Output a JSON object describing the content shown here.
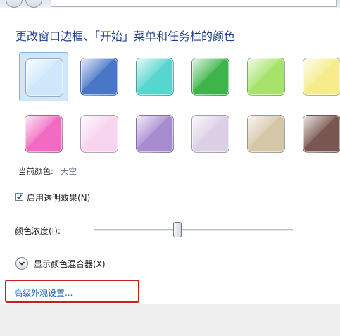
{
  "heading": "更改窗口边框、「开始」菜单和任务栏的颜色",
  "colors": {
    "link": "#1a5fb4",
    "heading": "#1e3d8f",
    "highlight": "#c81e1e",
    "selected_background": "#cfe6fb"
  },
  "swatches": [
    {
      "name": "sky",
      "color": "#cfe7fb",
      "selected": true
    },
    {
      "name": "twilight",
      "color": "#4a76c8",
      "selected": false
    },
    {
      "name": "sea",
      "color": "#55d6cf",
      "selected": false
    },
    {
      "name": "leaf",
      "color": "#3db54a",
      "selected": false
    },
    {
      "name": "lime",
      "color": "#a7e26b",
      "selected": false
    },
    {
      "name": "lemon",
      "color": "#f6ec8c",
      "selected": false
    },
    {
      "name": "fuchsia",
      "color": "#f26bc2",
      "selected": false
    },
    {
      "name": "blush",
      "color": "#f8d4ef",
      "selected": false
    },
    {
      "name": "violet",
      "color": "#a78bcf",
      "selected": false
    },
    {
      "name": "lavender",
      "color": "#dccfe6",
      "selected": false
    },
    {
      "name": "taupe",
      "color": "#d5c6a8",
      "selected": false
    },
    {
      "name": "chocolate",
      "color": "#7a5650",
      "selected": false
    }
  ],
  "current_color_label": "当前颜色:",
  "current_color_value": "天空",
  "transparency": {
    "label": "启用透明效果(N)",
    "checked": true
  },
  "intensity": {
    "label": "颜色浓度(I):",
    "level": 0.42
  },
  "mixer_label": "显示颜色混合器(X)",
  "advanced_link": "高级外观设置..."
}
